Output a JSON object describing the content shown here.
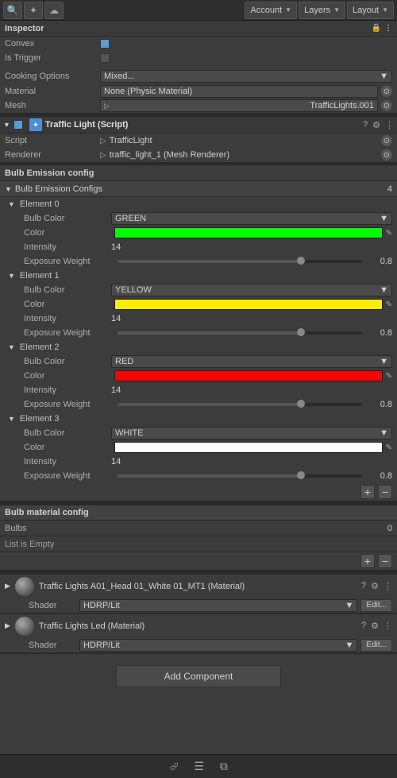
{
  "topbar": {
    "search_icon": "🔍",
    "star_icon": "★",
    "cloud_icon": "☁",
    "account_label": "Account",
    "layers_label": "Layers",
    "layout_label": "Layout"
  },
  "inspector": {
    "title": "Inspector",
    "convex_label": "Convex",
    "is_trigger_label": "Is Trigger",
    "cooking_options_label": "Cooking Options",
    "cooking_options_value": "Mixed...",
    "material_label": "Material",
    "material_value": "None (Physic Material)",
    "mesh_label": "Mesh",
    "mesh_value": "TrafficLights.001"
  },
  "script_component": {
    "title": "Traffic Light (Script)",
    "script_label": "Script",
    "script_value": "TrafficLight",
    "renderer_label": "Renderer",
    "renderer_value": "traffic_light_1 (Mesh Renderer)"
  },
  "bulb_emission": {
    "config_label": "Bulb Emission config",
    "configs_label": "Bulb Emission Configs",
    "configs_count": "4",
    "elements": [
      {
        "name": "Element 0",
        "bulb_color_label": "Bulb Color",
        "bulb_color_value": "GREEN",
        "color_label": "Color",
        "color_hex": "#00ff00",
        "intensity_label": "Intensity",
        "intensity_value": "14",
        "weight_label": "Exposure Weight",
        "weight_value": "0.8",
        "weight_pct": 75
      },
      {
        "name": "Element 1",
        "bulb_color_label": "Bulb Color",
        "bulb_color_value": "YELLOW",
        "color_label": "Color",
        "color_hex": "#ffee00",
        "intensity_label": "Intensity",
        "intensity_value": "14",
        "weight_label": "Exposure Weight",
        "weight_value": "0.8",
        "weight_pct": 75
      },
      {
        "name": "Element 2",
        "bulb_color_label": "Bulb Color",
        "bulb_color_value": "RED",
        "color_label": "Color",
        "color_hex": "#ff0000",
        "intensity_label": "Intensity",
        "intensity_value": "14",
        "weight_label": "Exposure Weight",
        "weight_value": "0.8",
        "weight_pct": 75
      },
      {
        "name": "Element 3",
        "bulb_color_label": "Bulb Color",
        "bulb_color_value": "WHITE",
        "color_label": "Color",
        "color_hex": "#ffffff",
        "intensity_label": "Intensity",
        "intensity_value": "14",
        "weight_label": "Exposure Weight",
        "weight_value": "0.8",
        "weight_pct": 75
      }
    ]
  },
  "bulb_material": {
    "config_label": "Bulb material config",
    "bulbs_label": "Bulbs",
    "bulbs_count": "0",
    "list_empty_label": "List is Empty"
  },
  "materials": [
    {
      "title": "Traffic Lights A01_Head 01_White 01_MT1 (Material)",
      "shader_label": "Shader",
      "shader_value": "HDRP/Lit",
      "edit_label": "Edit..."
    },
    {
      "title": "Traffic Lights Led (Material)",
      "shader_label": "Shader",
      "shader_value": "HDRP/Lit",
      "edit_label": "Edit..."
    }
  ],
  "add_component": {
    "label": "Add Component"
  },
  "bottom_bar": {
    "icon1": "⟨",
    "icon2": "☰",
    "icon3": "⊞"
  }
}
